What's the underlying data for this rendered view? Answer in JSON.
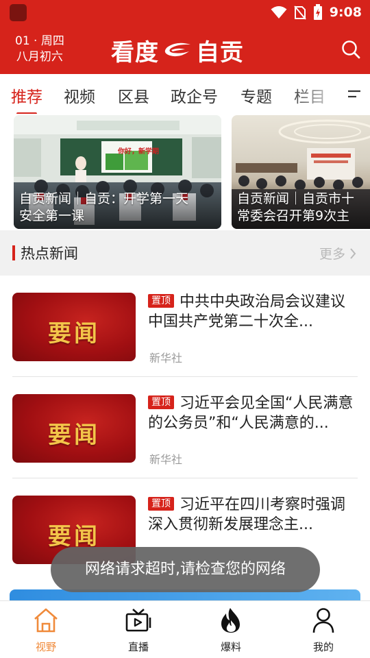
{
  "status_bar": {
    "time": "9:08"
  },
  "header": {
    "date_line1": "01 · 周四",
    "date_line2": "八月初六",
    "logo_left": "看度",
    "logo_right": "自贡"
  },
  "tabs": [
    {
      "label": "推荐",
      "active": true
    },
    {
      "label": "视频"
    },
    {
      "label": "区县"
    },
    {
      "label": "政企号"
    },
    {
      "label": "专题"
    },
    {
      "label": "栏目"
    }
  ],
  "banners": [
    {
      "caption_line1": "自贡新闻｜自贡：开学第一天",
      "caption_line2": "安全第一课",
      "board_text": "你好，新学期"
    },
    {
      "caption_line1": "自贡新闻｜自贡市十",
      "caption_line2": "常委会召开第9次主"
    }
  ],
  "section": {
    "title": "热点新闻",
    "more_label": "更多"
  },
  "news": [
    {
      "badge": "置顶",
      "title": "中共中央政治局会议建议  中国共产党第二十次全...",
      "source": "新华社",
      "thumb_text": "要闻"
    },
    {
      "badge": "置顶",
      "title": "习近平会见全国“人民满意的公务员”和“人民满意的...",
      "source": "新华社",
      "thumb_text": "要闻"
    },
    {
      "badge": "置顶",
      "title": "习近平在四川考察时强调  深入贯彻新发展理念主...",
      "source": "",
      "thumb_text": "要闻"
    }
  ],
  "toast": {
    "message": "网络请求超时,请检查您的网络"
  },
  "bottom_nav": [
    {
      "label": "视野",
      "icon": "home-icon",
      "active": true
    },
    {
      "label": "直播",
      "icon": "tv-icon"
    },
    {
      "label": "爆料",
      "icon": "flame-icon"
    },
    {
      "label": "我的",
      "icon": "person-icon"
    }
  ],
  "colors": {
    "brand_red": "#d6231b",
    "nav_active": "#f08a3a",
    "logo_gold": "#f3c64a"
  }
}
